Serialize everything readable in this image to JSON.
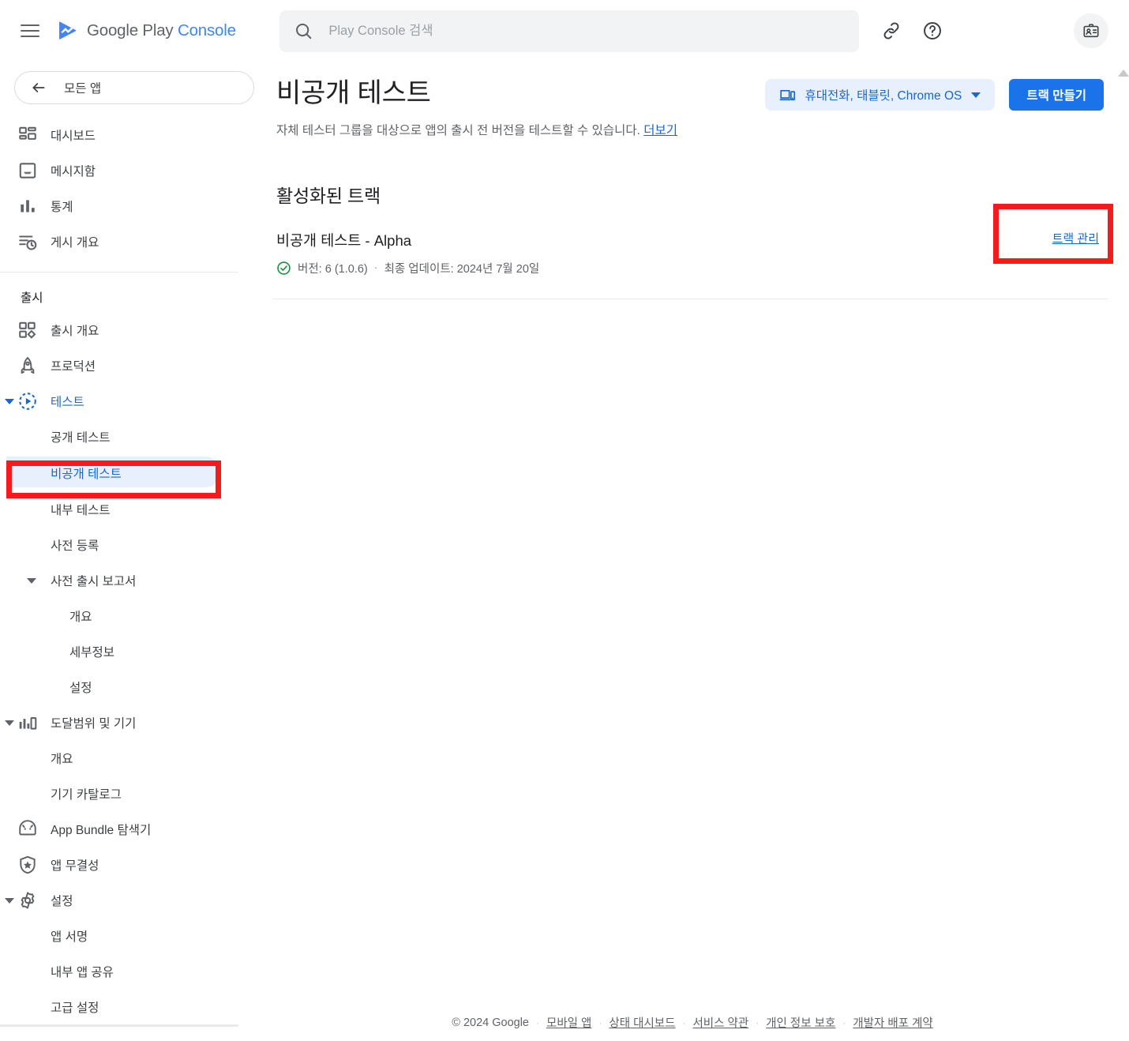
{
  "brand": {
    "google_play": "Google Play",
    "console": "Console",
    "logo_icon": "play-triangle-icon",
    "menu_icon": "hamburger-menu-icon"
  },
  "search": {
    "placeholder": "Play Console 검색",
    "value": "",
    "icon": "search-icon"
  },
  "topbar_icons": [
    {
      "name": "link-icon",
      "label": "링크"
    },
    {
      "name": "help-circle-icon",
      "label": "도움말"
    },
    {
      "name": "account-badge-icon",
      "label": "계정"
    }
  ],
  "sidebar": {
    "all_apps": {
      "label": "모든 앱",
      "icon": "arrow-back-icon"
    },
    "primary_items": [
      {
        "label": "대시보드",
        "icon": "dashboard-icon"
      },
      {
        "label": "메시지함",
        "icon": "inbox-icon"
      },
      {
        "label": "통계",
        "icon": "bar-chart-icon"
      },
      {
        "label": "게시 개요",
        "icon": "publishing-overview-icon"
      }
    ],
    "section_label": "출시",
    "release_items": [
      {
        "label": "출시 개요",
        "icon": "release-overview-icon",
        "level": 0,
        "expandable": false,
        "active": false
      },
      {
        "label": "프로덕션",
        "icon": "rocket-icon",
        "level": 0,
        "expandable": false,
        "active": false
      },
      {
        "label": "테스트",
        "icon": "testing-icon",
        "level": 0,
        "expandable": true,
        "expanded": true,
        "active": true
      },
      {
        "label": "공개 테스트",
        "icon": "",
        "level": 1,
        "expandable": false,
        "active": false
      },
      {
        "label": "비공개 테스트",
        "icon": "",
        "level": 1,
        "expandable": false,
        "active": true,
        "highlighted": true
      },
      {
        "label": "내부 테스트",
        "icon": "",
        "level": 1,
        "expandable": false,
        "active": false
      },
      {
        "label": "사전 등록",
        "icon": "",
        "level": 1,
        "expandable": false,
        "active": false
      },
      {
        "label": "사전 출시 보고서",
        "icon": "",
        "level": 1,
        "expandable": true,
        "expanded": true,
        "active": false
      },
      {
        "label": "개요",
        "icon": "",
        "level": 2,
        "expandable": false,
        "active": false
      },
      {
        "label": "세부정보",
        "icon": "",
        "level": 2,
        "expandable": false,
        "active": false
      },
      {
        "label": "설정",
        "icon": "",
        "level": 2,
        "expandable": false,
        "active": false
      },
      {
        "label": "도달범위 및 기기",
        "icon": "reach-devices-icon",
        "level": 0,
        "expandable": true,
        "expanded": true,
        "active": false
      },
      {
        "label": "개요",
        "icon": "",
        "level": 1,
        "expandable": false,
        "active": false
      },
      {
        "label": "기기 카탈로그",
        "icon": "",
        "level": 1,
        "expandable": false,
        "active": false
      },
      {
        "label": "App Bundle 탐색기",
        "icon": "android-bundle-icon",
        "level": 0,
        "expandable": false,
        "active": false
      },
      {
        "label": "앱 무결성",
        "icon": "shield-star-icon",
        "level": 0,
        "expandable": false,
        "active": false
      },
      {
        "label": "설정",
        "icon": "gear-icon",
        "level": 0,
        "expandable": true,
        "expanded": true,
        "active": false
      },
      {
        "label": "앱 서명",
        "icon": "",
        "level": 1,
        "expandable": false,
        "active": false
      },
      {
        "label": "내부 앱 공유",
        "icon": "",
        "level": 1,
        "expandable": false,
        "active": false
      },
      {
        "label": "고급 설정",
        "icon": "",
        "level": 1,
        "expandable": false,
        "active": false
      }
    ]
  },
  "main": {
    "title": "비공개 테스트",
    "subtitle": "자체 테스터 그룹을 대상으로 앱의 출시 전 버전을 테스트할 수 있습니다.",
    "subtitle_link": "더보기",
    "device_chip": {
      "label": "휴대전화, 태블릿, Chrome OS",
      "icon": "device-tablet-icon"
    },
    "create_track_button": "트랙 만들기",
    "section_title": "활성화된 트랙",
    "track": {
      "name": "비공개 테스트 - Alpha",
      "status_icon": "check-circle-icon",
      "version": "버전: 6 (1.0.6)",
      "separator": "·",
      "last_update": "최종 업데이트: 2024년 7월 20일",
      "manage_label": "트랙 관리"
    }
  },
  "footer": {
    "copyright": "© 2024 Google",
    "links": [
      "모바일 앱",
      "상태 대시보드",
      "서비스 약관",
      "개인 정보 보호",
      "개발자 배포 계약"
    ],
    "separator": "·"
  },
  "colors": {
    "accent_blue": "#1a73e8",
    "link_blue": "#1967d2",
    "chip_bg": "#e8f0fe",
    "highlight_red": "#f41b1b",
    "status_green": "#1e8e3e",
    "text_primary": "#202124",
    "text_secondary": "#5f6368"
  }
}
